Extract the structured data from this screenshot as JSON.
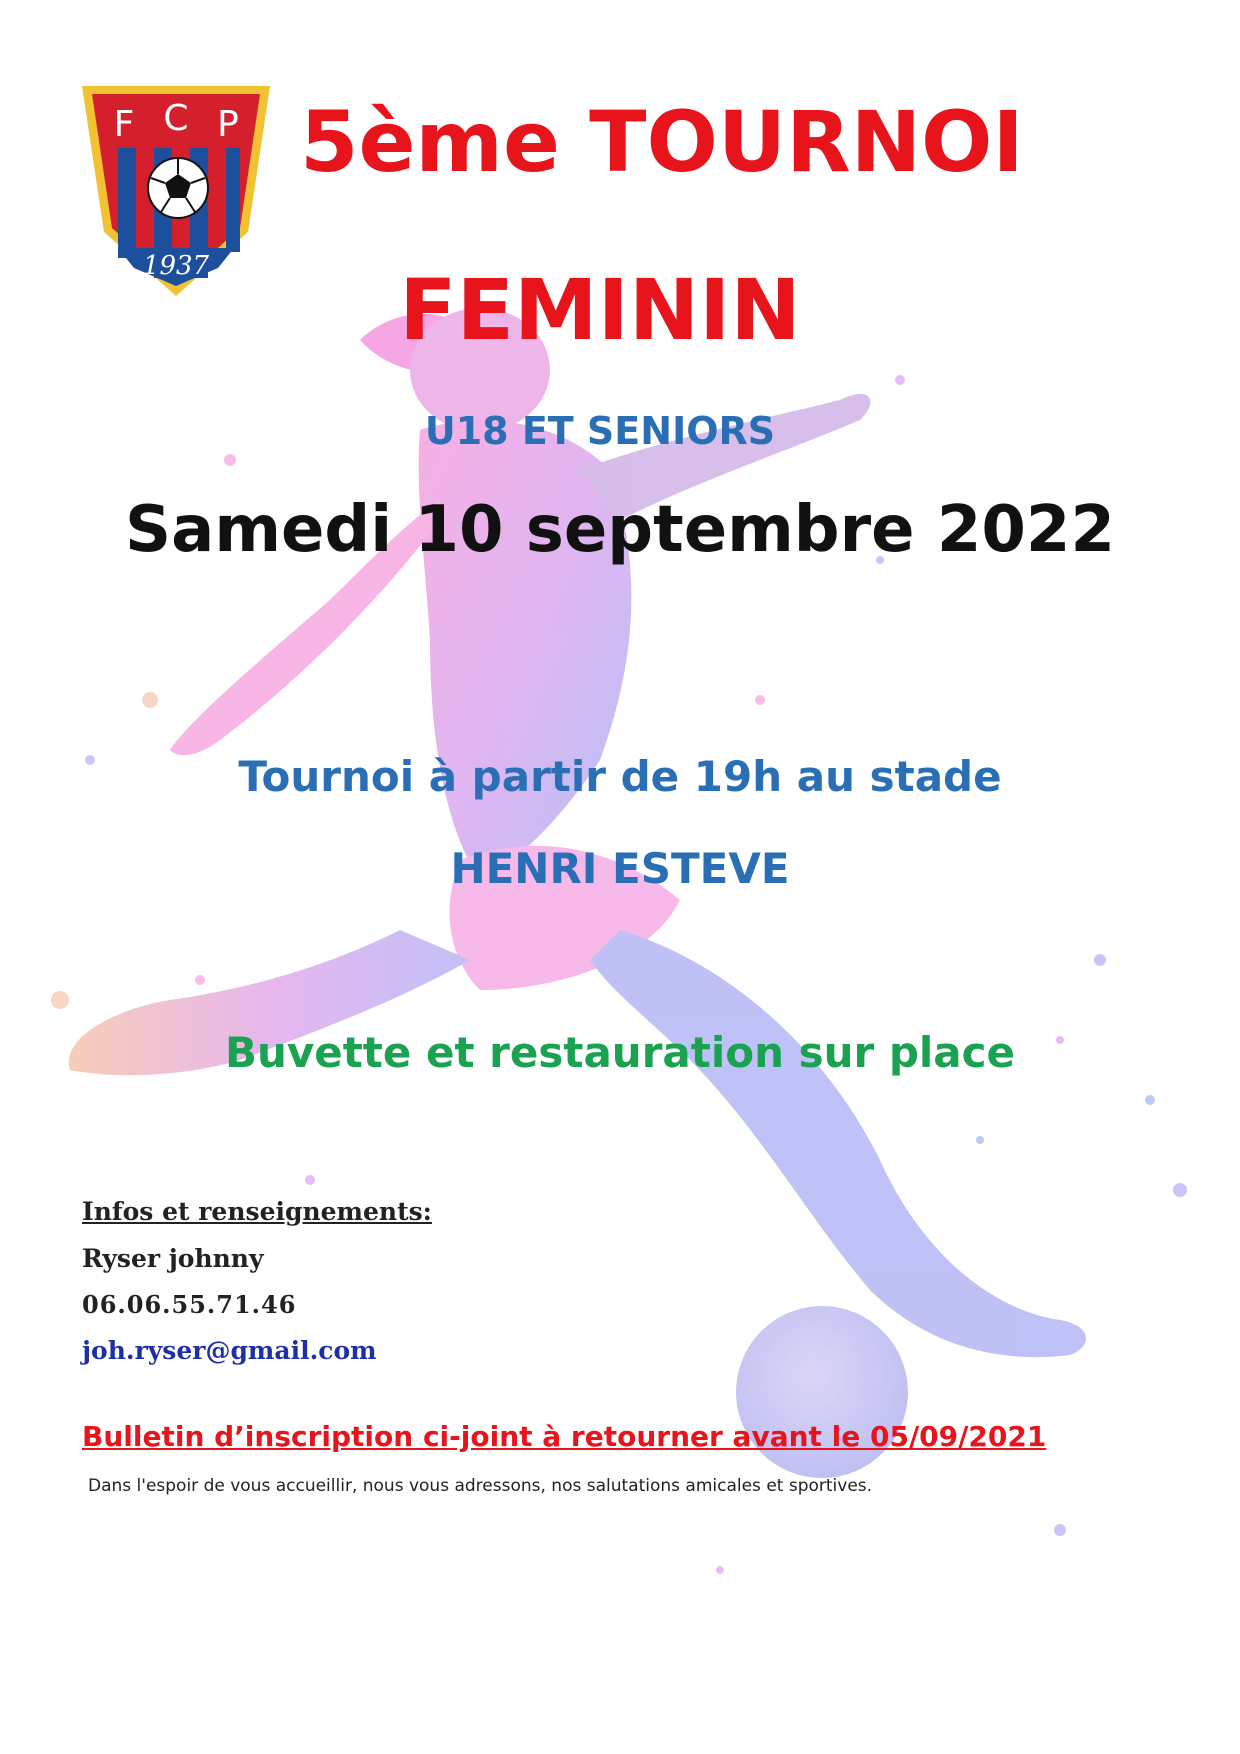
{
  "crest": {
    "letters": [
      "F",
      "C",
      "P"
    ],
    "year": "1937",
    "colors": {
      "red": "#d4202c",
      "blue": "#1e4f9d",
      "gold": "#f1c232"
    }
  },
  "header": {
    "title_line1": "5ème  TOURNOI",
    "title_line2": "FEMININ"
  },
  "categories": "U18 ET SENIORS",
  "date": "Samedi 10 septembre 2022",
  "schedule": {
    "line1": "Tournoi à partir de 19h au stade",
    "line2": "HENRI ESTEVE"
  },
  "amenities": "Buvette et restauration sur place",
  "contact": {
    "heading": "Infos et renseignements:",
    "name": "Ryser johnny",
    "phone": "06.06.55.71.46",
    "email": "joh.ryser@gmail.com"
  },
  "registration": "Bulletin d’inscription ci-joint à retourner avant le 05/09/2021",
  "closing": "Dans l'espoir de vous accueillir, nous vous adressons, nos salutations amicales et sportives.",
  "artwork": {
    "subject": "watercolor-female-footballer-silhouette",
    "colors": [
      "#f06ac8",
      "#c86ae8",
      "#8f7cf0",
      "#6f8ae8",
      "#f0a07a"
    ]
  }
}
